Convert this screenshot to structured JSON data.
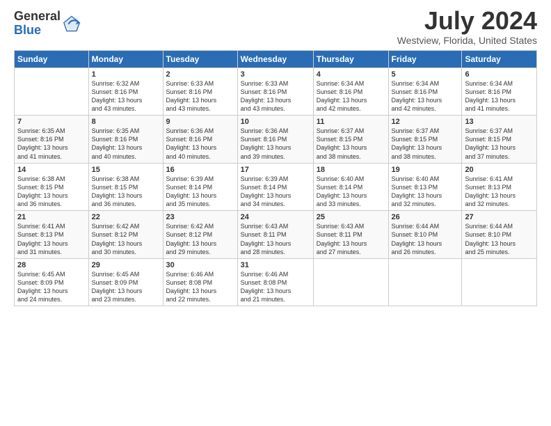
{
  "header": {
    "logo_line1": "General",
    "logo_line2": "Blue",
    "month": "July 2024",
    "location": "Westview, Florida, United States"
  },
  "columns": [
    "Sunday",
    "Monday",
    "Tuesday",
    "Wednesday",
    "Thursday",
    "Friday",
    "Saturday"
  ],
  "weeks": [
    [
      {
        "day": "",
        "info": ""
      },
      {
        "day": "1",
        "info": "Sunrise: 6:32 AM\nSunset: 8:16 PM\nDaylight: 13 hours\nand 43 minutes."
      },
      {
        "day": "2",
        "info": "Sunrise: 6:33 AM\nSunset: 8:16 PM\nDaylight: 13 hours\nand 43 minutes."
      },
      {
        "day": "3",
        "info": "Sunrise: 6:33 AM\nSunset: 8:16 PM\nDaylight: 13 hours\nand 43 minutes."
      },
      {
        "day": "4",
        "info": "Sunrise: 6:34 AM\nSunset: 8:16 PM\nDaylight: 13 hours\nand 42 minutes."
      },
      {
        "day": "5",
        "info": "Sunrise: 6:34 AM\nSunset: 8:16 PM\nDaylight: 13 hours\nand 42 minutes."
      },
      {
        "day": "6",
        "info": "Sunrise: 6:34 AM\nSunset: 8:16 PM\nDaylight: 13 hours\nand 41 minutes."
      }
    ],
    [
      {
        "day": "7",
        "info": "Sunrise: 6:35 AM\nSunset: 8:16 PM\nDaylight: 13 hours\nand 41 minutes."
      },
      {
        "day": "8",
        "info": "Sunrise: 6:35 AM\nSunset: 8:16 PM\nDaylight: 13 hours\nand 40 minutes."
      },
      {
        "day": "9",
        "info": "Sunrise: 6:36 AM\nSunset: 8:16 PM\nDaylight: 13 hours\nand 40 minutes."
      },
      {
        "day": "10",
        "info": "Sunrise: 6:36 AM\nSunset: 8:16 PM\nDaylight: 13 hours\nand 39 minutes."
      },
      {
        "day": "11",
        "info": "Sunrise: 6:37 AM\nSunset: 8:15 PM\nDaylight: 13 hours\nand 38 minutes."
      },
      {
        "day": "12",
        "info": "Sunrise: 6:37 AM\nSunset: 8:15 PM\nDaylight: 13 hours\nand 38 minutes."
      },
      {
        "day": "13",
        "info": "Sunrise: 6:37 AM\nSunset: 8:15 PM\nDaylight: 13 hours\nand 37 minutes."
      }
    ],
    [
      {
        "day": "14",
        "info": "Sunrise: 6:38 AM\nSunset: 8:15 PM\nDaylight: 13 hours\nand 36 minutes."
      },
      {
        "day": "15",
        "info": "Sunrise: 6:38 AM\nSunset: 8:15 PM\nDaylight: 13 hours\nand 36 minutes."
      },
      {
        "day": "16",
        "info": "Sunrise: 6:39 AM\nSunset: 8:14 PM\nDaylight: 13 hours\nand 35 minutes."
      },
      {
        "day": "17",
        "info": "Sunrise: 6:39 AM\nSunset: 8:14 PM\nDaylight: 13 hours\nand 34 minutes."
      },
      {
        "day": "18",
        "info": "Sunrise: 6:40 AM\nSunset: 8:14 PM\nDaylight: 13 hours\nand 33 minutes."
      },
      {
        "day": "19",
        "info": "Sunrise: 6:40 AM\nSunset: 8:13 PM\nDaylight: 13 hours\nand 32 minutes."
      },
      {
        "day": "20",
        "info": "Sunrise: 6:41 AM\nSunset: 8:13 PM\nDaylight: 13 hours\nand 32 minutes."
      }
    ],
    [
      {
        "day": "21",
        "info": "Sunrise: 6:41 AM\nSunset: 8:13 PM\nDaylight: 13 hours\nand 31 minutes."
      },
      {
        "day": "22",
        "info": "Sunrise: 6:42 AM\nSunset: 8:12 PM\nDaylight: 13 hours\nand 30 minutes."
      },
      {
        "day": "23",
        "info": "Sunrise: 6:42 AM\nSunset: 8:12 PM\nDaylight: 13 hours\nand 29 minutes."
      },
      {
        "day": "24",
        "info": "Sunrise: 6:43 AM\nSunset: 8:11 PM\nDaylight: 13 hours\nand 28 minutes."
      },
      {
        "day": "25",
        "info": "Sunrise: 6:43 AM\nSunset: 8:11 PM\nDaylight: 13 hours\nand 27 minutes."
      },
      {
        "day": "26",
        "info": "Sunrise: 6:44 AM\nSunset: 8:10 PM\nDaylight: 13 hours\nand 26 minutes."
      },
      {
        "day": "27",
        "info": "Sunrise: 6:44 AM\nSunset: 8:10 PM\nDaylight: 13 hours\nand 25 minutes."
      }
    ],
    [
      {
        "day": "28",
        "info": "Sunrise: 6:45 AM\nSunset: 8:09 PM\nDaylight: 13 hours\nand 24 minutes."
      },
      {
        "day": "29",
        "info": "Sunrise: 6:45 AM\nSunset: 8:09 PM\nDaylight: 13 hours\nand 23 minutes."
      },
      {
        "day": "30",
        "info": "Sunrise: 6:46 AM\nSunset: 8:08 PM\nDaylight: 13 hours\nand 22 minutes."
      },
      {
        "day": "31",
        "info": "Sunrise: 6:46 AM\nSunset: 8:08 PM\nDaylight: 13 hours\nand 21 minutes."
      },
      {
        "day": "",
        "info": ""
      },
      {
        "day": "",
        "info": ""
      },
      {
        "day": "",
        "info": ""
      }
    ]
  ]
}
